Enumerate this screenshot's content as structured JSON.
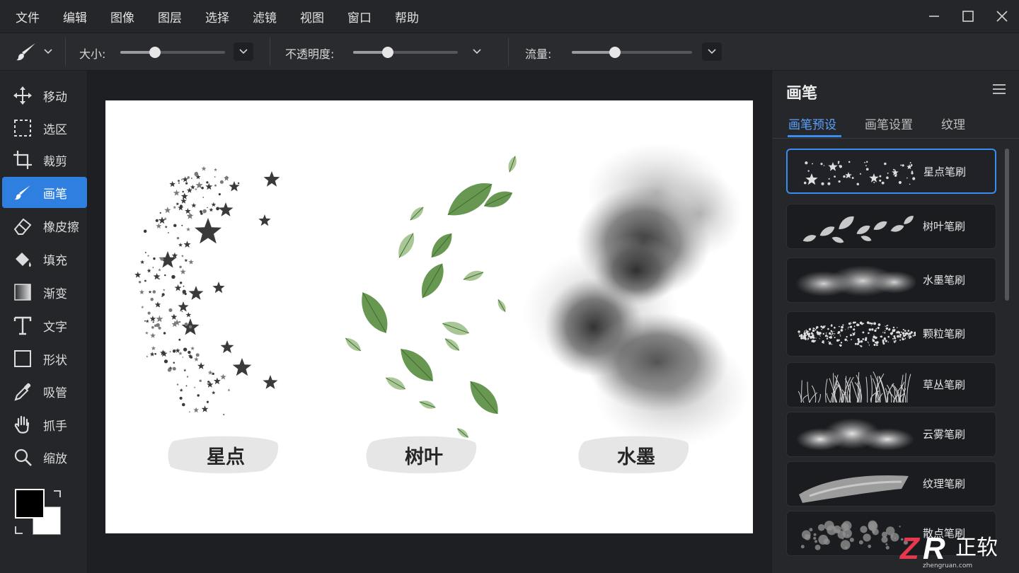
{
  "menubar": {
    "items": [
      "文件",
      "编辑",
      "图像",
      "图层",
      "选择",
      "滤镜",
      "视图",
      "窗口",
      "帮助"
    ]
  },
  "options": {
    "size_label": "大小:",
    "size_value": 0.33,
    "opacity_label": "不透明度:",
    "opacity_value": 0.33,
    "flow_label": "流量:",
    "flow_value": 0.36
  },
  "tools": [
    {
      "label": "移动",
      "icon": "move-icon"
    },
    {
      "label": "选区",
      "icon": "marquee-icon"
    },
    {
      "label": "裁剪",
      "icon": "crop-icon"
    },
    {
      "label": "画笔",
      "icon": "brush-icon",
      "active": true
    },
    {
      "label": "橡皮擦",
      "icon": "eraser-icon"
    },
    {
      "label": "填充",
      "icon": "bucket-icon"
    },
    {
      "label": "渐变",
      "icon": "gradient-icon"
    },
    {
      "label": "文字",
      "icon": "text-icon"
    },
    {
      "label": "形状",
      "icon": "shape-icon"
    },
    {
      "label": "吸管",
      "icon": "eyedropper-icon"
    },
    {
      "label": "抓手",
      "icon": "hand-icon"
    },
    {
      "label": "缩放",
      "icon": "zoom-icon"
    }
  ],
  "colors": {
    "foreground": "#000000",
    "background": "#ffffff",
    "accent": "#2f7fe0"
  },
  "canvas": {
    "labels": [
      "星点",
      "树叶",
      "水墨"
    ]
  },
  "panel": {
    "title": "画笔",
    "tabs": [
      "画笔预设",
      "画笔设置",
      "纹理"
    ],
    "active_tab": 0,
    "presets": [
      "星点笔刷",
      "树叶笔刷",
      "水墨笔刷",
      "颗粒笔刷",
      "草丛笔刷",
      "云雾笔刷",
      "纹理笔刷",
      "散点笔刷"
    ],
    "selected_preset": 0
  },
  "watermark": {
    "brand": "ZR 正软",
    "url": "zhengruan.com"
  }
}
